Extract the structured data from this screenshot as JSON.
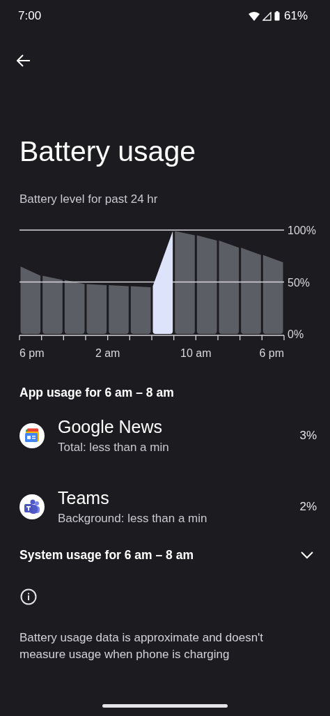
{
  "status_bar": {
    "time": "7:00",
    "battery": "61%"
  },
  "title": "Battery usage",
  "chart_section": {
    "subtitle": "Battery level for past 24 hr",
    "slots": [
      {
        "selected": false
      },
      {
        "selected": false
      },
      {
        "selected": false
      },
      {
        "selected": false
      },
      {
        "selected": false
      },
      {
        "selected": false
      },
      {
        "selected": true
      },
      {
        "selected": false
      },
      {
        "selected": false
      },
      {
        "selected": false
      },
      {
        "selected": false
      },
      {
        "selected": false
      }
    ],
    "chart_data": {
      "type": "bar",
      "categories": [
        "6 pm",
        null,
        null,
        null,
        "2 am",
        null,
        null,
        null,
        "10 am",
        null,
        null,
        "6 pm"
      ],
      "series": [
        {
          "color": "#5c5e66",
          "values": [
            65,
            56,
            52,
            48,
            47,
            46,
            null,
            99,
            95,
            90,
            83,
            76
          ]
        }
      ],
      "ylim": [
        0,
        100
      ],
      "yticks": [
        {
          "value": 0,
          "label": "0%"
        },
        {
          "value": 50,
          "label": "50%"
        },
        {
          "value": 100,
          "label": "100%"
        }
      ]
    }
  },
  "app_usage": {
    "heading": "App usage for 6 am – 8 am",
    "apps": [
      {
        "kind": "news",
        "name": "Google News",
        "detail": "Total: less than a min",
        "percent": "3%"
      },
      {
        "kind": "teams",
        "name": "Teams",
        "detail": "Background: less than a min",
        "percent": "2%"
      }
    ]
  },
  "system_usage": {
    "heading": "System usage for 6 am – 8 am",
    "expanded": false
  },
  "footer": "Battery usage data is approximate and doesn't measure usage when phone is charging"
}
